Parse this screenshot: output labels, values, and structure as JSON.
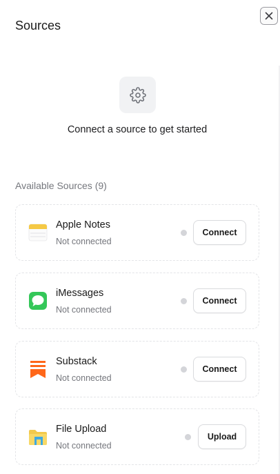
{
  "header": {
    "title": "Sources",
    "close_label": "×"
  },
  "empty_state": {
    "icon": "gear-icon",
    "message": "Connect a source to get started"
  },
  "available": {
    "heading": "Available Sources (9)",
    "items": [
      {
        "name": "Apple Notes",
        "status": "Not connected",
        "action": "Connect",
        "icon": "apple-notes-icon"
      },
      {
        "name": "iMessages",
        "status": "Not connected",
        "action": "Connect",
        "icon": "imessages-icon"
      },
      {
        "name": "Substack",
        "status": "Not connected",
        "action": "Connect",
        "icon": "substack-icon"
      },
      {
        "name": "File Upload",
        "status": "Not connected",
        "action": "Upload",
        "icon": "folder-icon"
      }
    ]
  },
  "colors": {
    "status_dot": "#d4d5d9",
    "imessages_green": "#34c759",
    "substack_orange": "#ff6719",
    "notes_yellow": "#f5c945"
  }
}
